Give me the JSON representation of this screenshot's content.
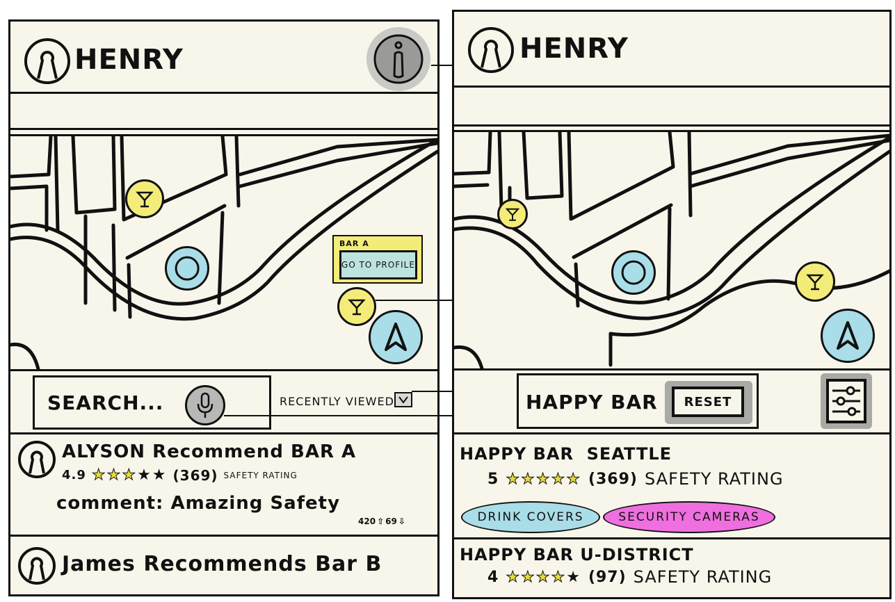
{
  "app": {
    "name": "HENRY"
  },
  "left": {
    "popup": {
      "title": "BAR A",
      "button": "GO TO PROFILE"
    },
    "search": {
      "placeholder": "SEARCH...",
      "recent_label": "RECENTLY VIEWED"
    },
    "feed": [
      {
        "title": "ALYSON Recommend BAR A",
        "rating": "4.9",
        "count": "(369)",
        "rating_label": "SAFETY RATING",
        "comment": "comment: Amazing Safety",
        "upvotes": "420",
        "downvotes": "69"
      },
      {
        "title": "James Recommends Bar B"
      }
    ]
  },
  "right": {
    "search": {
      "value": "HAPPY BAR",
      "reset": "RESET"
    },
    "results": [
      {
        "name": "HAPPY BAR  SEATTLE",
        "rating": "5",
        "count": "(369)",
        "rating_label": "SAFETY RATING",
        "tags": [
          "DRINK COVERS",
          "SECURITY CAMERAS"
        ]
      },
      {
        "name": "HAPPY BAR U-DISTRICT",
        "rating": "4",
        "count": "(97)",
        "rating_label": "SAFETY RATING"
      }
    ]
  },
  "colors": {
    "background": "#f8f6ea",
    "pin": "#f4ec79",
    "location": "#a9dde8",
    "highlight": "#f4ec79",
    "tag_blue": "#a9dde8",
    "tag_pink": "#ef6fe0"
  }
}
